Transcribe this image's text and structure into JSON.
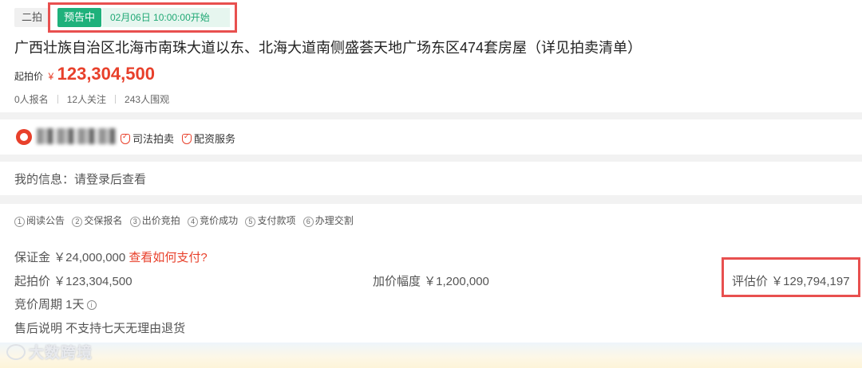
{
  "header": {
    "round": "二拍",
    "status_badge": "预告中",
    "status_time": "02月06日 10:00:00开始",
    "title": "广西壮族自治区北海市南珠大道以东、北海大道南侧盛荟天地广场东区474套房屋（详见拍卖清单）",
    "start_price_label": "起拍价",
    "currency_symbol": "¥",
    "start_price_value": "123,304,500",
    "stats": {
      "registered": "0人报名",
      "followers": "12人关注",
      "viewers": "243人围观"
    }
  },
  "org": {
    "cert_judicial": "司法拍卖",
    "cert_finance": "配资服务"
  },
  "my_info": "我的信息：请登录后查看",
  "steps": [
    {
      "num": "1",
      "label": "阅读公告"
    },
    {
      "num": "2",
      "label": "交保报名"
    },
    {
      "num": "3",
      "label": "出价竞拍"
    },
    {
      "num": "4",
      "label": "竞价成功"
    },
    {
      "num": "5",
      "label": "支付款项"
    },
    {
      "num": "6",
      "label": "办理交割"
    }
  ],
  "details": {
    "deposit": "保证金 ￥24,000,000",
    "deposit_link": "查看如何支付?",
    "start_price": "起拍价 ￥123,304,500",
    "increment": "加价幅度 ￥1,200,000",
    "evaluation": "评估价 ￥129,794,197",
    "cycle": "竞价周期 1天",
    "after_sale": "售后说明 不支持七天无理由退货"
  },
  "watermark": "大数跨境",
  "colors": {
    "accent_red": "#e8402b",
    "status_green": "#1fb17b",
    "highlight_box": "#e8504f"
  }
}
